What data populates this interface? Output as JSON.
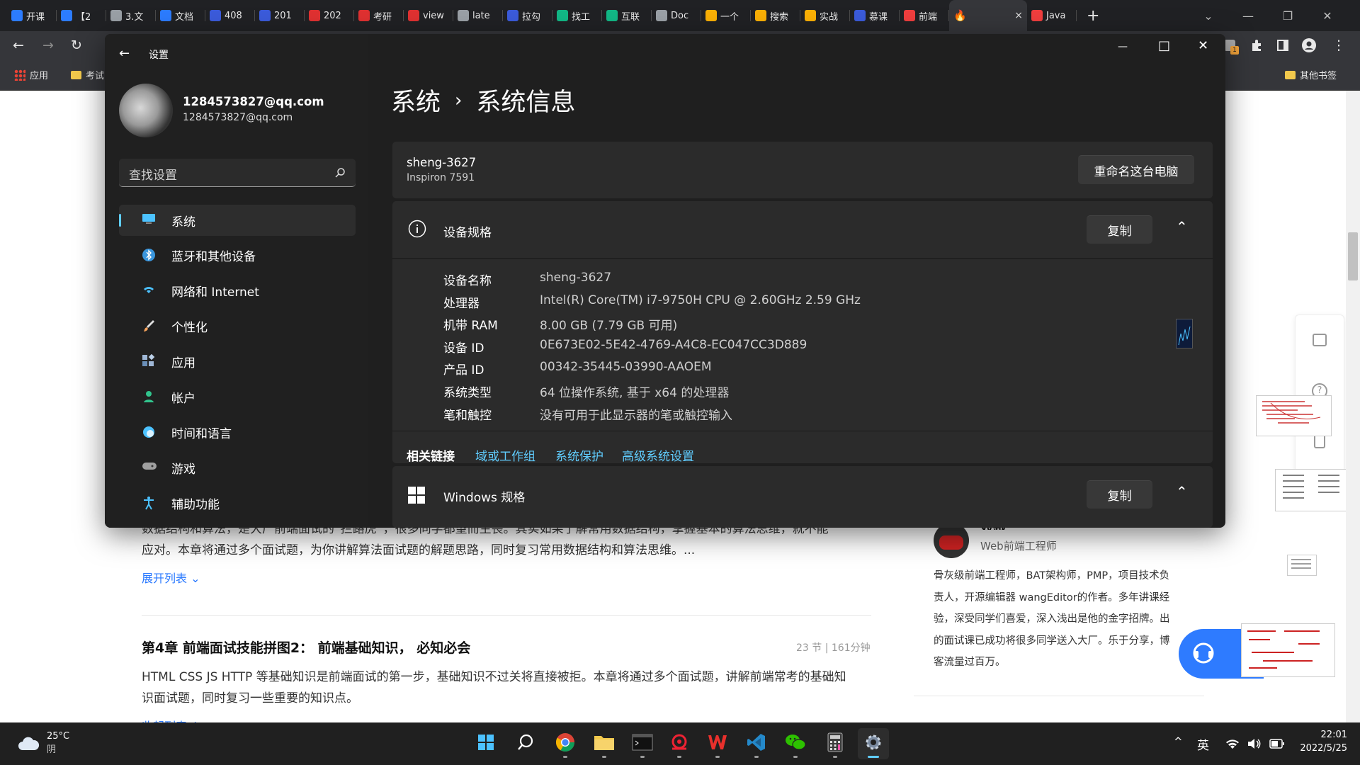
{
  "browser": {
    "tabs": [
      {
        "label": "开课",
        "color": "#2c7cff"
      },
      {
        "label": "【2",
        "color": "#2c7cff"
      },
      {
        "label": "3.文",
        "color": "#9aa0a6"
      },
      {
        "label": "文档",
        "color": "#2c7cff"
      },
      {
        "label": "408",
        "color": "#3b5bdb"
      },
      {
        "label": "201",
        "color": "#3b5bdb"
      },
      {
        "label": "202",
        "color": "#e03131"
      },
      {
        "label": "考研",
        "color": "#e03131"
      },
      {
        "label": "view",
        "color": "#e03131"
      },
      {
        "label": "late",
        "color": "#9aa0a6"
      },
      {
        "label": "拉勾",
        "color": "#3b5bdb"
      },
      {
        "label": "找工",
        "color": "#12b886"
      },
      {
        "label": "互联",
        "color": "#12b886"
      },
      {
        "label": "Doc",
        "color": "#9aa0a6"
      },
      {
        "label": "一个",
        "color": "#fab005"
      },
      {
        "label": "搜索",
        "color": "#fab005"
      },
      {
        "label": "实战",
        "color": "#fab005"
      },
      {
        "label": "慕课",
        "color": "#3b5bdb"
      },
      {
        "label": "前端",
        "color": "#f03e3e"
      }
    ],
    "active_tab": {
      "label": "",
      "close": "×"
    },
    "last_tab": {
      "label": "Java",
      "color": "#f03e3e"
    },
    "new_tab": "+",
    "window_controls": {
      "dropdown": "⌄",
      "minimize": "—",
      "restore": "❐",
      "close": "✕"
    },
    "nav": {
      "back": "←",
      "forward": "→",
      "reload": "↻"
    },
    "bookmarks": {
      "apps": "应用",
      "kaoshi": "考试",
      "other": "其他书签"
    }
  },
  "webpage": {
    "para1": "数据结构和算法，是大厂前端面试的“拦路虎”，很多同学都望而生畏。其实如果了解常用数据结构，掌握基本的算法思维，就不能",
    "para1b": "应对。本章将通过多个面试题，为你讲解算法面试题的解题思路，同时复习常用数据结构和算法思维。...",
    "expand_list": "展开列表 ⌄",
    "chapter_title": "第4章 前端面试技能拼图2： 前端基础知识， 必知必会",
    "chapter_meta": "23 节 | 161分钟",
    "chapter_desc1": "HTML CSS JS HTTP 等基础知识是前端面试的第一步，基础知识不过关将直接被拒。本章将通过多个面试题，讲解前端常考的基础知",
    "chapter_desc2": "识面试题，同时复习一些重要的知识点。",
    "collapse_list": "收起列表 ⌃",
    "teacher_name": "双越",
    "teacher_title": "Web前端工程师",
    "teacher_bio": [
      "骨灰级前端工程师，BAT架构师，PMP，项目技术负",
      "责人，开源编辑器 wangEditor的作者。多年讲课经",
      "验，深受同学们喜爱，深入浅出是他的金字招牌。出",
      "的面试课已成功将很多同学送入大厂。乐于分享，博",
      "客流量过百万。"
    ]
  },
  "settings": {
    "title": "设置",
    "back_icon": "←",
    "window_controls": {
      "minimize": "—",
      "maximize": "□",
      "close": "✕"
    },
    "account": {
      "name": "1284573827@qq.com",
      "email": "1284573827@qq.com"
    },
    "search": {
      "placeholder": "查找设置"
    },
    "sidebar": [
      {
        "label": "系统",
        "icon": "monitor-icon",
        "color": "#4cc2ff"
      },
      {
        "label": "蓝牙和其他设备",
        "icon": "bluetooth-icon",
        "color": "#3a96dd"
      },
      {
        "label": "网络和 Internet",
        "icon": "wifi-icon",
        "color": "#4cc2ff"
      },
      {
        "label": "个性化",
        "icon": "brush-icon",
        "color": "#f7a35c"
      },
      {
        "label": "应用",
        "icon": "apps-icon",
        "color": "#9fb7d6"
      },
      {
        "label": "帐户",
        "icon": "person-icon",
        "color": "#31c48d"
      },
      {
        "label": "时间和语言",
        "icon": "globe-icon",
        "color": "#4cc2ff"
      },
      {
        "label": "游戏",
        "icon": "gamepad-icon",
        "color": "#a0a0a0"
      },
      {
        "label": "辅助功能",
        "icon": "accessibility-icon",
        "color": "#4cc2ff"
      }
    ],
    "breadcrumb": {
      "parent": "系统",
      "separator": "›",
      "current": "系统信息"
    },
    "device": {
      "name": "sheng-3627",
      "model": "Inspiron 7591",
      "rename_button": "重命名这台电脑"
    },
    "device_specs": {
      "title": "设备规格",
      "copy_button": "复制",
      "collapse": "⌃",
      "rows": [
        {
          "label": "设备名称",
          "value": "sheng-3627"
        },
        {
          "label": "处理器",
          "value": "Intel(R) Core(TM) i7-9750H CPU @ 2.60GHz   2.59 GHz"
        },
        {
          "label": "机带 RAM",
          "value": "8.00 GB (7.79 GB 可用)"
        },
        {
          "label": "设备 ID",
          "value": "0E673E02-5E42-4769-A4C8-EC047CC3D889"
        },
        {
          "label": "产品 ID",
          "value": "00342-35445-03990-AAOEM"
        },
        {
          "label": "系统类型",
          "value": "64 位操作系统, 基于 x64 的处理器"
        },
        {
          "label": "笔和触控",
          "value": "没有可用于此显示器的笔或触控输入"
        }
      ]
    },
    "related_links": {
      "label": "相关链接",
      "links": [
        "域或工作组",
        "系统保护",
        "高级系统设置"
      ]
    },
    "windows_specs": {
      "title": "Windows 规格",
      "copy_button": "复制",
      "collapse": "⌃"
    }
  },
  "taskbar": {
    "weather": {
      "temp": "25°C",
      "condition": "阴"
    },
    "apps": [
      {
        "name": "start-button",
        "icon": "windows-icon"
      },
      {
        "name": "search-button",
        "icon": "search-icon"
      },
      {
        "name": "chrome-app",
        "icon": "chrome-icon"
      },
      {
        "name": "file-explorer-app",
        "icon": "folder-icon"
      },
      {
        "name": "terminal-app",
        "icon": "terminal-icon"
      },
      {
        "name": "snail-app",
        "icon": "snail-icon"
      },
      {
        "name": "wps-app",
        "icon": "wps-icon"
      },
      {
        "name": "vscode-app",
        "icon": "vscode-icon"
      },
      {
        "name": "wechat-app",
        "icon": "wechat-icon"
      },
      {
        "name": "calculator-app",
        "icon": "calculator-icon"
      },
      {
        "name": "settings-app",
        "icon": "gear-icon"
      }
    ],
    "tray": {
      "chevron": "^",
      "ime": "英",
      "time": "22:01",
      "date": "2022/5/25"
    }
  }
}
